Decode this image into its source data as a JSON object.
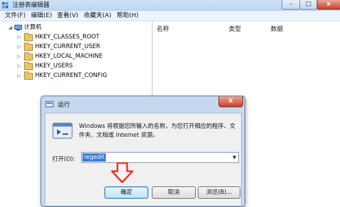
{
  "window": {
    "title": "注册表编辑器",
    "controls": {
      "minimize": "–",
      "maximize": "□",
      "close": "x"
    }
  },
  "menubar": {
    "items": [
      "文件(F)",
      "编辑(E)",
      "查看(V)",
      "收藏夹(A)",
      "帮助(H)"
    ]
  },
  "tree": {
    "root_label": "计算机",
    "keys": [
      "HKEY_CLASSES_ROOT",
      "HKEY_CURRENT_USER",
      "HKEY_LOCAL_MACHINE",
      "HKEY_USERS",
      "HKEY_CURRENT_CONFIG"
    ]
  },
  "list": {
    "columns": [
      "名称",
      "类型",
      "数据"
    ]
  },
  "run_dialog": {
    "title": "运行",
    "close": "x",
    "description": "Windows 将根据您所输入的名称，为您打开相应的程序、文件夹、文档或 Internet 资源。",
    "open_label": "打开(O):",
    "open_value": "regedit",
    "buttons": {
      "ok": "确定",
      "cancel": "取消",
      "browse": "浏览(B)..."
    }
  },
  "colors": {
    "highlight": "#3a78d1",
    "arrow": "#e0352b",
    "titlebar": "#cfe3f7",
    "dialog_frame": "#c7d9ee"
  }
}
